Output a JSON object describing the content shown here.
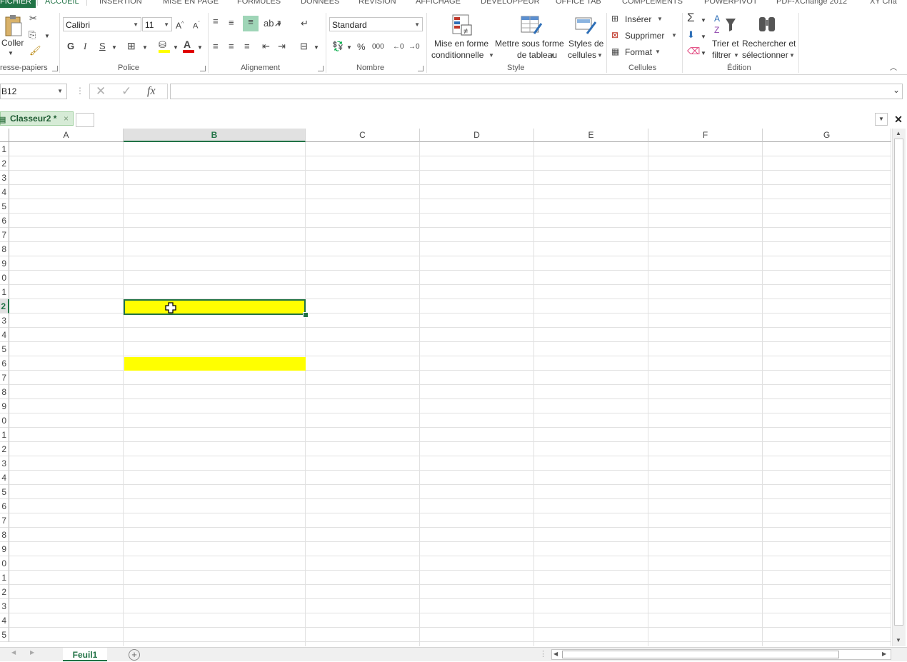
{
  "ribbon_tabs": {
    "file": "FICHIER",
    "home": "ACCUEIL",
    "insert": "INSERTION",
    "layout": "MISE EN PAGE",
    "formulas": "FORMULES",
    "data": "DONNÉES",
    "review": "RÉVISION",
    "view": "AFFICHAGE",
    "developer": "DÉVELOPPEUR",
    "office_tab": "OFFICE TAB",
    "addins": "COMPLÉMENTS",
    "powerpivot": "POWERPIVOT",
    "pdf": "PDF-XChange 2012",
    "xy": "XY Cha"
  },
  "clipboard": {
    "paste_label": "Coller",
    "group_label": "resse-papiers"
  },
  "font": {
    "name": "Calibri",
    "size": "11",
    "bold": "G",
    "italic": "I",
    "underline": "S",
    "color_letter": "A",
    "group_label": "Police"
  },
  "alignment": {
    "group_label": "Alignement"
  },
  "number": {
    "format": "Standard",
    "percent": "%",
    "thousands": "000",
    "group_label": "Nombre"
  },
  "style": {
    "conditional_line1": "Mise en forme",
    "conditional_line2": "conditionnelle",
    "table_line1": "Mettre sous forme",
    "table_line2": "de tableau",
    "cell_line1": "Styles de",
    "cell_line2": "cellules",
    "group_label": "Style"
  },
  "cells": {
    "insert": "Insérer",
    "delete": "Supprimer",
    "format": "Format",
    "group_label": "Cellules"
  },
  "editing": {
    "sort_line1": "Trier et",
    "sort_line2": "filtrer",
    "find_line1": "Rechercher et",
    "find_line2": "sélectionner",
    "group_label": "Édition"
  },
  "formula_bar": {
    "name_box": "B12",
    "fx": "fx",
    "value": ""
  },
  "workbook_tab": {
    "title": "Classeur2 *",
    "close": "×"
  },
  "columns": [
    "A",
    "B",
    "C",
    "D",
    "E",
    "F",
    "G"
  ],
  "selected_column": "B",
  "rows": [
    "1",
    "2",
    "3",
    "4",
    "5",
    "6",
    "7",
    "8",
    "9",
    "0",
    "1",
    "2",
    "3",
    "4",
    "5",
    "6",
    "7",
    "8",
    "9",
    "0",
    "1",
    "2",
    "3",
    "4",
    "5",
    "6",
    "7",
    "8",
    "9",
    "0",
    "1",
    "2",
    "3",
    "4",
    "5"
  ],
  "selected_row_index": 11,
  "sheet": {
    "name": "Feuil1",
    "add": "+"
  },
  "highlight_color": "#FFFF00",
  "accent_color": "#217346"
}
